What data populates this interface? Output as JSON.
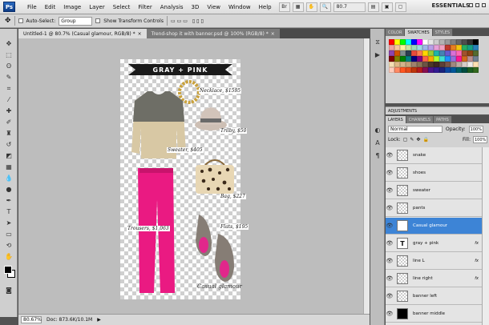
{
  "menubar": {
    "logo": "Ps",
    "items": [
      "File",
      "Edit",
      "Image",
      "Layer",
      "Select",
      "Filter",
      "Analysis",
      "3D",
      "View",
      "Window",
      "Help"
    ],
    "zoom": "80.7",
    "workspace": "ESSENTIALS"
  },
  "options": {
    "auto_select_label": "Auto-Select:",
    "auto_select_value": "Group",
    "transform_label": "Show Transform Controls"
  },
  "tabs": [
    {
      "label": "Untitled-1 @ 80.7% (Casual glamour, RGB/8) *"
    },
    {
      "label": "Trend-shop it with banner.psd @ 100% (RGB/8) *"
    }
  ],
  "canvas": {
    "banner": "GRAY + PINK",
    "labels": {
      "necklace": "Necklace, $1595",
      "trilby": "Trilby, $50",
      "sweater": "Sweater, $405",
      "bag": "Bag, $227",
      "trousers": "Trousers, $1,063",
      "flats": "Flats, $195"
    },
    "signature": "Casual glamour"
  },
  "status": {
    "zoom": "80.67%",
    "doc": "Doc: 873.6K/10.1M"
  },
  "panels": {
    "color_tabs": [
      "COLOR",
      "SWATCHES",
      "STYLES"
    ],
    "adjustments": "ADJUSTMENTS",
    "layer_tabs": [
      "LAYERS",
      "CHANNELS",
      "PATHS"
    ],
    "blend_mode": "Normal",
    "opacity_label": "Opacity:",
    "opacity": "100%",
    "lock_label": "Lock:",
    "fill_label": "Fill:",
    "fill": "100%"
  },
  "swatch_colors": [
    "#ff0000",
    "#ffff00",
    "#00ff00",
    "#00ffff",
    "#0000ff",
    "#ff00ff",
    "#ffffff",
    "#e6e6e6",
    "#cccccc",
    "#b3b3b3",
    "#999999",
    "#808080",
    "#666666",
    "#4d4d4d",
    "#333333",
    "#000000",
    "#f0a0a0",
    "#f6c89a",
    "#fbf2a0",
    "#c8e6a0",
    "#a0d8b8",
    "#a0d8e6",
    "#a0b8e6",
    "#b8a0e6",
    "#e6a0d8",
    "#f0a0c0",
    "#c0392b",
    "#e67e22",
    "#f1c40f",
    "#27ae60",
    "#16a085",
    "#2980b9",
    "#8e44ad",
    "#d35400",
    "#7f8c8d",
    "#2c3e50",
    "#e74c3c",
    "#ff7f50",
    "#ffd700",
    "#9acd32",
    "#20b2aa",
    "#4682b4",
    "#6a5acd",
    "#da70d6",
    "#ff69b4",
    "#a0522d",
    "#8b4513",
    "#556b2f",
    "#800000",
    "#808000",
    "#008000",
    "#008080",
    "#000080",
    "#800080",
    "#ff6347",
    "#ffa500",
    "#adff2f",
    "#40e0d0",
    "#1e90ff",
    "#9370db",
    "#ff1493",
    "#d2691e",
    "#bc8f8f",
    "#708090",
    "#f5deb3",
    "#deb887",
    "#d2b48c",
    "#c4a57b",
    "#a0826d",
    "#8b7355",
    "#6b5344",
    "#4a3728",
    "#3e2723",
    "#5d4037",
    "#795548",
    "#a1887f",
    "#bcaaa4",
    "#d7ccc8",
    "#efebe9",
    "#ffe0b2",
    "#ffccbc",
    "#ff8a65",
    "#ff5722",
    "#e64a19",
    "#bf360c",
    "#b71c1c",
    "#880e4f",
    "#4a148c",
    "#311b92",
    "#1a237e",
    "#0d47a1",
    "#01579b",
    "#006064",
    "#004d40",
    "#1b5e20",
    "#33691e"
  ],
  "layers": [
    {
      "name": "snake",
      "thumb": "check",
      "fx": ""
    },
    {
      "name": "shoes",
      "thumb": "check",
      "fx": ""
    },
    {
      "name": "sweater",
      "thumb": "check",
      "fx": ""
    },
    {
      "name": "pants",
      "thumb": "check",
      "fx": ""
    },
    {
      "name": "Casual glamour",
      "thumb": "T",
      "fx": "",
      "selected": true
    },
    {
      "name": "gray + pink",
      "thumb": "T",
      "fx": "fx"
    },
    {
      "name": "line L",
      "thumb": "check",
      "fx": "fx"
    },
    {
      "name": "line right",
      "thumb": "check",
      "fx": "fx"
    },
    {
      "name": "banner left",
      "thumb": "check",
      "fx": ""
    },
    {
      "name": "banner middle",
      "thumb": "black",
      "fx": ""
    }
  ]
}
